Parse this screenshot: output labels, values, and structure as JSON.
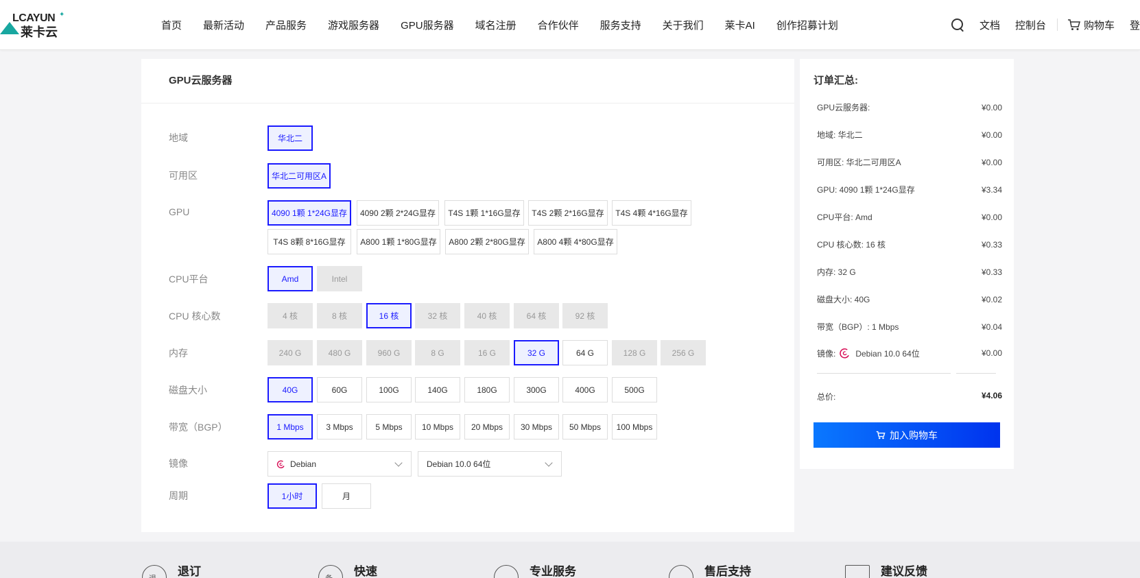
{
  "header": {
    "logo_en": "LCAYUN",
    "logo_cn": "莱卡云",
    "nav": [
      "首页",
      "最新活动",
      "产品服务",
      "游戏服务器",
      "GPU服务器",
      "域名注册",
      "合作伙伴",
      "服务支持",
      "关于我们",
      "莱卡AI",
      "创作招募计划"
    ],
    "docs": "文档",
    "console": "控制台",
    "cart": "购物车",
    "login": "登"
  },
  "main": {
    "title": "GPU云服务器",
    "region_label": "地域",
    "region_options": [
      "华北二"
    ],
    "zone_label": "可用区",
    "zone_options": [
      "华北二可用区A"
    ],
    "gpu_label": "GPU",
    "gpu_options": [
      "4090 1颗 1*24G显存",
      "4090 2颗 2*24G显存",
      "T4S 1颗 1*16G显存",
      "T4S 2颗 2*16G显存",
      "T4S 4颗 4*16G显存",
      "T4S 8颗 8*16G显存",
      "A800 1颗 1*80G显存",
      "A800 2颗 2*80G显存",
      "A800 4颗 4*80G显存"
    ],
    "cpu_platform_label": "CPU平台",
    "cpu_platform_options": [
      "Amd",
      "Intel"
    ],
    "cpu_cores_label": "CPU 核心数",
    "cpu_cores_options": [
      "4 核",
      "8 核",
      "16 核",
      "32 核",
      "40 核",
      "64 核",
      "92 核"
    ],
    "memory_label": "内存",
    "memory_options": [
      "240 G",
      "480 G",
      "960 G",
      "8 G",
      "16 G",
      "32 G",
      "64 G",
      "128 G",
      "256 G"
    ],
    "disk_label": "磁盘大小",
    "disk_options": [
      "40G",
      "60G",
      "100G",
      "140G",
      "180G",
      "300G",
      "400G",
      "500G"
    ],
    "bandwidth_label": "带宽（BGP）",
    "bandwidth_options": [
      "1 Mbps",
      "3 Mbps",
      "5 Mbps",
      "10 Mbps",
      "20 Mbps",
      "30 Mbps",
      "50 Mbps",
      "100 Mbps"
    ],
    "image_label": "镜像",
    "image_os": "Debian",
    "image_version": "Debian 10.0 64位",
    "period_label": "周期",
    "period_options": [
      "1小时",
      "月"
    ]
  },
  "summary": {
    "title": "订单汇总:",
    "rows": [
      {
        "label": "GPU云服务器:",
        "value": "¥0.00"
      },
      {
        "label": "地域: 华北二",
        "value": "¥0.00"
      },
      {
        "label": "可用区: 华北二可用区A",
        "value": "¥0.00"
      },
      {
        "label": "GPU: 4090 1颗 1*24G显存",
        "value": "¥3.34"
      },
      {
        "label": "CPU平台: Amd",
        "value": "¥0.00"
      },
      {
        "label": "CPU 核心数: 16 核",
        "value": "¥0.33"
      },
      {
        "label": "内存: 32 G",
        "value": "¥0.33"
      },
      {
        "label": "磁盘大小: 40G",
        "value": "¥0.02"
      },
      {
        "label": "带宽（BGP）: 1 Mbps",
        "value": "¥0.04"
      }
    ],
    "image_row_label": "镜像:",
    "image_row_name": "Debian 10.0 64位",
    "image_row_value": "¥0.00",
    "total_label": "总价:",
    "total_value": "¥4.06",
    "add_cart": "加入购物车"
  },
  "footer": {
    "items": [
      {
        "icon": "退",
        "label": "退订"
      },
      {
        "icon": "备",
        "label": "快速"
      },
      {
        "icon": "",
        "label": "专业服务"
      },
      {
        "icon": "",
        "label": "售后支持"
      },
      {
        "icon": "",
        "label": "建议反馈"
      }
    ]
  },
  "colors": {
    "accent": "#1a1aff",
    "logo": "#18a7a0",
    "button_start": "#0a78ff",
    "button_end": "#0033ee"
  }
}
